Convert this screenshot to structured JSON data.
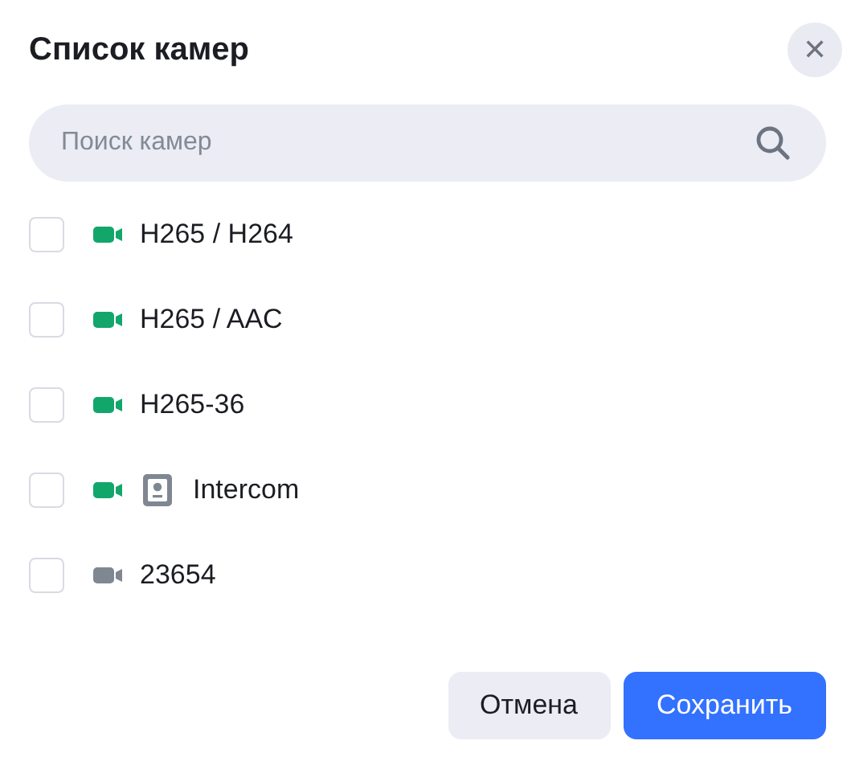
{
  "dialog": {
    "title": "Список камер",
    "close_label": "✕"
  },
  "search": {
    "placeholder": "Поиск камер"
  },
  "cameras": [
    {
      "name": "H265 / H264",
      "kind": "camera",
      "online": true,
      "checked": false
    },
    {
      "name": "H265 / AAC",
      "kind": "camera",
      "online": true,
      "checked": false
    },
    {
      "name": "H265-36",
      "kind": "camera",
      "online": true,
      "checked": false
    },
    {
      "name": "Intercom",
      "kind": "intercom",
      "online": true,
      "checked": false
    },
    {
      "name": "23654",
      "kind": "camera",
      "online": false,
      "checked": false
    }
  ],
  "buttons": [
    {
      "label": "Отмена",
      "kind": "secondary"
    },
    {
      "label": "Сохранить",
      "kind": "primary"
    }
  ]
}
